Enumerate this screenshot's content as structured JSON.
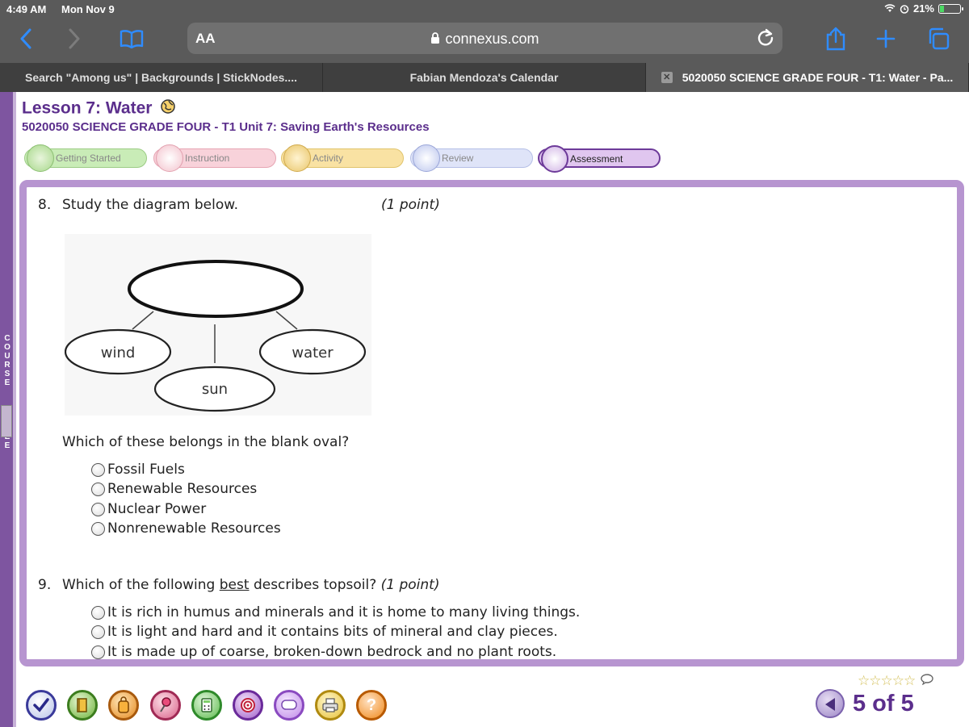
{
  "status_bar": {
    "time": "4:49 AM",
    "date": "Mon Nov 9",
    "battery": "21%",
    "battery_level": 0.21
  },
  "browser": {
    "text_size_label": "AA",
    "url": "connexus.com",
    "accent_color": "#2f8cff",
    "tabs": [
      {
        "label": "Search \"Among us\" | Backgrounds | StickNodes....",
        "active": false
      },
      {
        "label": "Fabian Mendoza's Calendar",
        "active": false
      },
      {
        "label": "5020050 SCIENCE GRADE FOUR - T1: Water - Pa...",
        "active": true
      }
    ]
  },
  "sidebar": {
    "label": "COURSE TREE"
  },
  "lesson": {
    "title": "Lesson 7: Water",
    "subtitle": "5020050 SCIENCE GRADE FOUR - T1  Unit 7: Saving Earth's Resources",
    "steps": [
      {
        "label": "Getting Started"
      },
      {
        "label": "Instruction"
      },
      {
        "label": "Activity"
      },
      {
        "label": "Review"
      },
      {
        "label": "Assessment"
      }
    ],
    "brand_color": "#5b2e8c"
  },
  "questions": [
    {
      "number": "8.",
      "prompt": "Study the diagram below.",
      "points": "(1 point)",
      "diagram_labels": {
        "left": "wind",
        "center": "sun",
        "right": "water"
      },
      "sub_prompt": "Which of these belongs in the blank oval?",
      "options": [
        "Fossil Fuels",
        "Renewable Resources",
        "Nuclear Power",
        "Nonrenewable Resources"
      ]
    },
    {
      "number": "9.",
      "prompt_pre": "Which of the following ",
      "prompt_emph": "best",
      "prompt_post": " describes topsoil?",
      "points": "(1 point)",
      "options": [
        "It is rich in humus and minerals and it is home to many living things.",
        "It is light and hard and it contains bits of mineral and clay pieces.",
        "It is made up of coarse, broken-down bedrock and no plant roots."
      ]
    }
  ],
  "footer": {
    "tool_icons": [
      "checkmark-icon",
      "book-icon",
      "backpack-icon",
      "pin-icon",
      "calculator-icon",
      "target-icon",
      "chat-icon",
      "printer-icon",
      "help-icon"
    ],
    "help_label": "?",
    "rating_stars": "☆☆☆☆☆",
    "page_label": "5 of 5"
  }
}
